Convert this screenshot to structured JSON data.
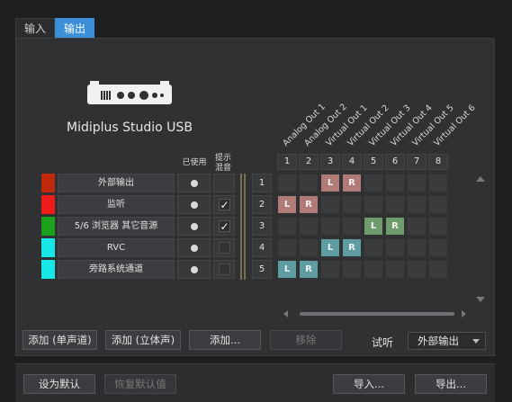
{
  "tabs": [
    {
      "label": "输入",
      "active": false
    },
    {
      "label": "输出",
      "active": true
    }
  ],
  "device": {
    "name": "Midiplus Studio USB",
    "icon": "audio-interface-icon"
  },
  "columns": {
    "in_use": "已使用",
    "mix": "提示\n混音"
  },
  "outputs": [
    "Analog Out 1",
    "Analog Out 2",
    "Virtual Out 1",
    "Virtual Out 2",
    "Virtual Out 3",
    "Virtual Out 4",
    "Virtual Out 5",
    "Virtual Out 6"
  ],
  "col_numbers": [
    "1",
    "2",
    "3",
    "4",
    "5",
    "6",
    "7",
    "8"
  ],
  "rows": [
    {
      "name": "外部输出",
      "color": "#c0290c",
      "in_use": true,
      "mix": null,
      "num": "1",
      "assign": {
        "3": "L",
        "4": "R"
      },
      "assign_color": "#b07a77"
    },
    {
      "name": "监听",
      "color": "#ee1b1b",
      "in_use": true,
      "mix": true,
      "num": "2",
      "assign": {
        "1": "L",
        "2": "R"
      },
      "assign_color": "#b07a77"
    },
    {
      "name": "5/6 浏览器 其它音源",
      "color": "#1aa01a",
      "in_use": true,
      "mix": true,
      "num": "3",
      "assign": {
        "5": "L",
        "6": "R"
      },
      "assign_color": "#6e9c6c"
    },
    {
      "name": "RVC",
      "color": "#16e8e8",
      "in_use": true,
      "mix": false,
      "num": "4",
      "assign": {
        "3": "L",
        "4": "R"
      },
      "assign_color": "#5e9ea3"
    },
    {
      "name": "旁路系统通道",
      "color": "#16e8e8",
      "in_use": true,
      "mix": false,
      "num": "5",
      "assign": {
        "1": "L",
        "2": "R"
      },
      "assign_color": "#5e9ea3"
    }
  ],
  "buttons": {
    "add_mono": "添加 (单声道)",
    "add_stereo": "添加 (立体声)",
    "add": "添加...",
    "remove": "移除"
  },
  "audition": {
    "label": "试听",
    "value": "外部输出"
  },
  "footer": {
    "set_default": "设为默认",
    "restore_default": "恢复默认值",
    "import": "导入...",
    "export": "导出..."
  }
}
